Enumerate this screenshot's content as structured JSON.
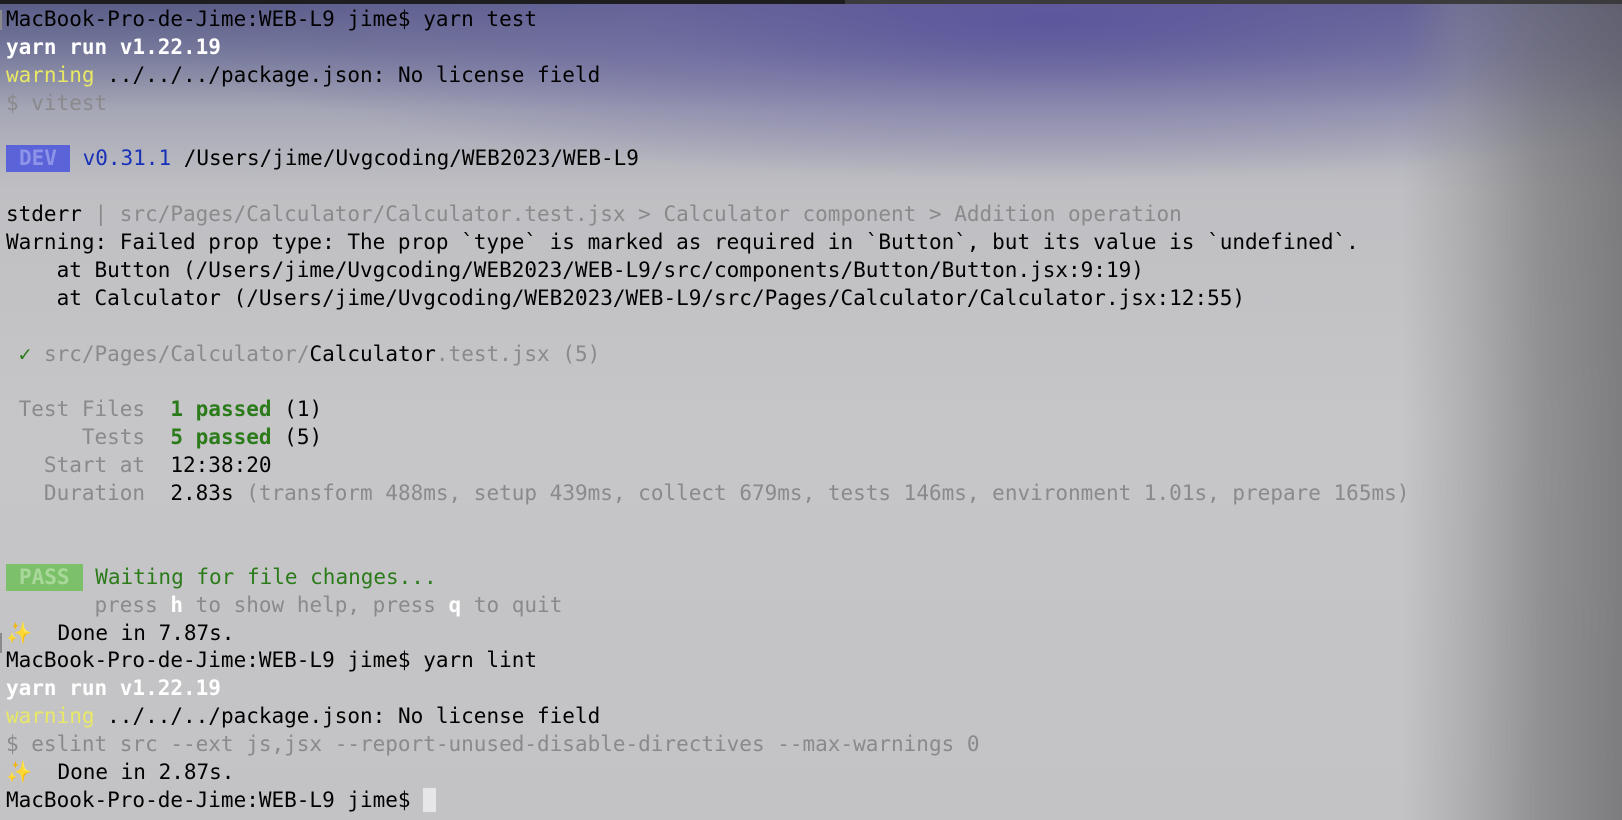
{
  "colors": {
    "dev_badge_bg": "#5a63d8",
    "pass_badge_bg": "#7dc06a",
    "version_blue": "#1730b8",
    "passed_green": "#2b7b1a",
    "warning_yellow": "#e8e866"
  },
  "lines": {
    "prompt1": "MacBook-Pro-de-Jime:WEB-L9 jime$ yarn test",
    "yarn_run1": "yarn run v1.22.19",
    "warning_word1": "warning",
    "warning_rest1": " ../../../package.json: No license field",
    "cmd_vitest": "$ vitest",
    "dev_badge": "DEV",
    "vitest_version": "v0.31.1",
    "project_path": " /Users/jime/Uvgcoding/WEB2023/WEB-L9",
    "stderr_label": "stderr",
    "stderr_sep": " | ",
    "stderr_context": "src/Pages/Calculator/Calculator.test.jsx > Calculator component > Addition operation",
    "prop_warning": "Warning: Failed prop type: The prop `type` is marked as required in `Button`, but its value is `undefined`.",
    "stack1": "    at Button (/Users/jime/Uvgcoding/WEB2023/WEB-L9/src/components/Button/Button.jsx:9:19)",
    "stack2": "    at Calculator (/Users/jime/Uvgcoding/WEB2023/WEB-L9/src/Pages/Calculator/Calculator.jsx:12:55)",
    "check_icon": "✓",
    "test_file_dir": " src/Pages/Calculator/",
    "test_file_name": "Calculator",
    "test_file_ext": ".test.jsx (5)",
    "test_files_label": " Test Files  ",
    "test_files_passed": "1 passed",
    "test_files_count": " (1)",
    "tests_label": "      Tests  ",
    "tests_passed": "5 passed",
    "tests_count": " (5)",
    "start_label": "   Start at  ",
    "start_value": "12:38:20",
    "duration_label": "   Duration  ",
    "duration_value": "2.83s",
    "duration_detail": " (transform 488ms, setup 439ms, collect 679ms, tests 146ms, environment 1.01s, prepare 165ms)",
    "pass_badge": "PASS",
    "waiting_text": " Waiting for file changes...",
    "help_press1": "       press ",
    "help_h": "h",
    "help_to_show": " to show help, press ",
    "help_q": "q",
    "help_to_quit": " to quit",
    "sparkle1": "✨",
    "done1": "  Done in 7.87s.",
    "prompt2": "MacBook-Pro-de-Jime:WEB-L9 jime$ yarn lint",
    "yarn_run2": "yarn run v1.22.19",
    "warning_word2": "warning",
    "warning_rest2": " ../../../package.json: No license field",
    "cmd_eslint": "$ eslint src --ext js,jsx --report-unused-disable-directives --max-warnings 0",
    "sparkle2": "✨",
    "done2": "  Done in 2.87s.",
    "prompt3": "MacBook-Pro-de-Jime:WEB-L9 jime$ "
  }
}
